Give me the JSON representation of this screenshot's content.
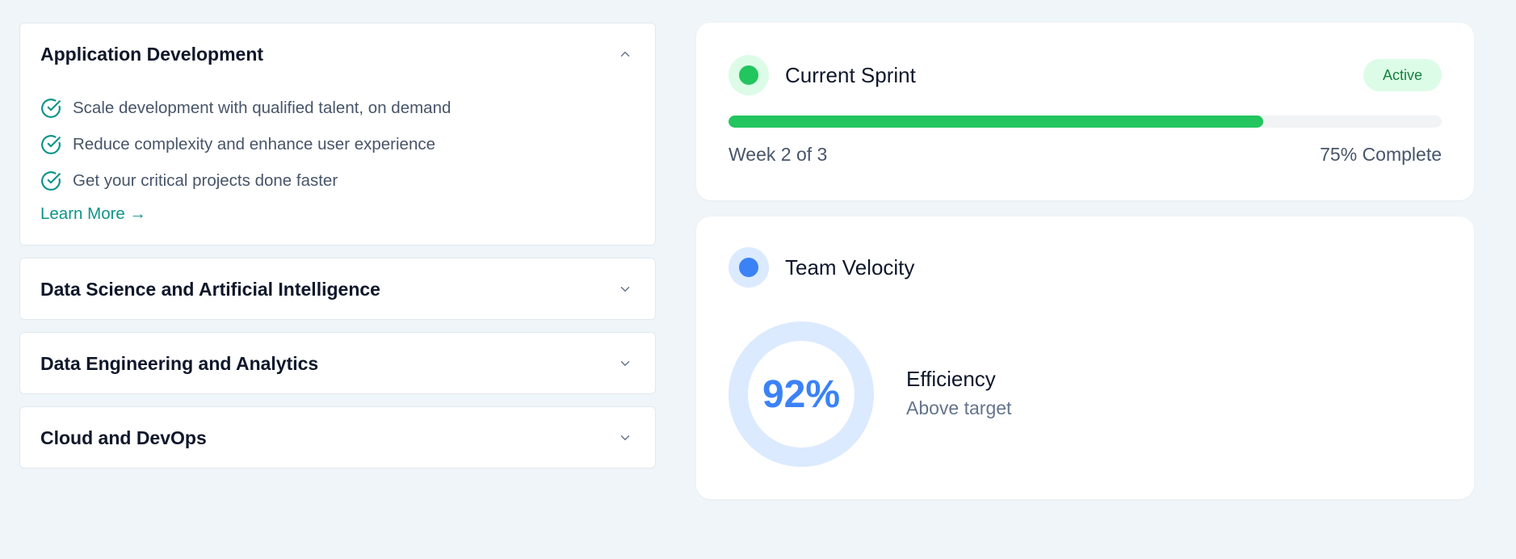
{
  "accordion": {
    "items": [
      {
        "title": "Application Development",
        "expanded": true,
        "features": [
          "Scale development with qualified talent, on demand",
          "Reduce complexity and enhance user experience",
          "Get your critical projects done faster"
        ],
        "link_label": "Learn More →"
      },
      {
        "title": "Data Science and Artificial Intelligence",
        "expanded": false
      },
      {
        "title": "Data Engineering and Analytics",
        "expanded": false
      },
      {
        "title": "Cloud and DevOps",
        "expanded": false
      }
    ],
    "icons": {
      "expanded": "chevron-up-icon",
      "collapsed": "chevron-down-icon",
      "feature": "check-circle-icon"
    },
    "accent_color": "#0d9488"
  },
  "sprint": {
    "title": "Current Sprint",
    "status_badge": "Active",
    "progress_fraction": 0.75,
    "progress_left_text": "Week 2 of 3",
    "progress_right_text": "75% Complete",
    "colors": {
      "dot": "#22c55e",
      "dot_bg": "#dcfce7",
      "bar": "#22c55e",
      "badge_bg": "#dcfce7",
      "badge_text": "#15803d"
    }
  },
  "velocity": {
    "title": "Team Velocity",
    "ring_value": "92%",
    "metric_label": "Efficiency",
    "metric_sub": "Above target",
    "colors": {
      "dot": "#3b82f6",
      "dot_bg": "#dbeafe",
      "ring": "#dbeafe",
      "value": "#3b82f6"
    }
  }
}
